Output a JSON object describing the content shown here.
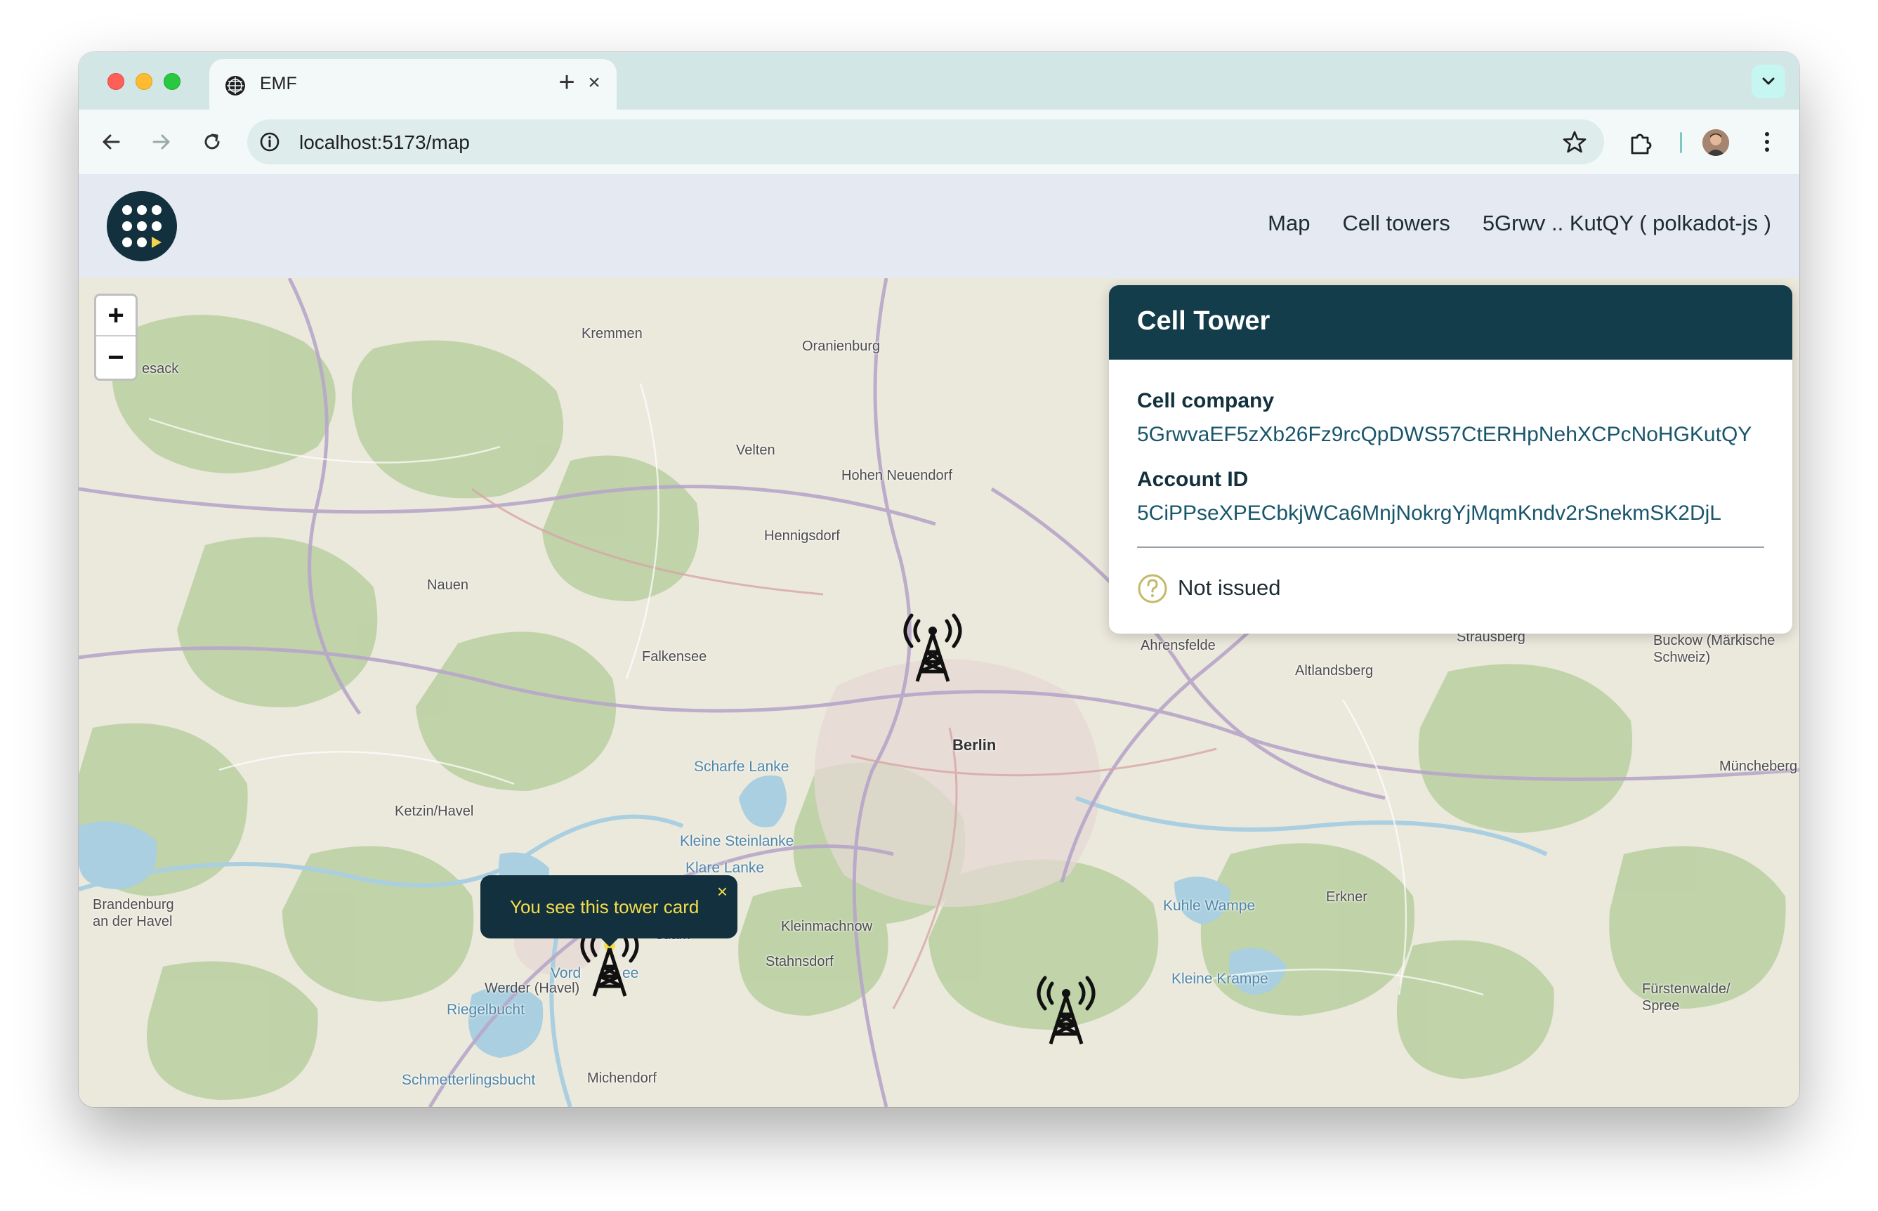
{
  "browser": {
    "tab_title": "EMF",
    "tab_close": "×",
    "new_tab": "+",
    "url": "localhost:5173/map"
  },
  "app": {
    "nav": {
      "map": "Map",
      "cell_towers": "Cell towers",
      "account": "5Grwv .. KutQY  ( polkadot-js )"
    }
  },
  "map": {
    "zoom_in": "+",
    "zoom_out": "−",
    "labels": [
      "Kremmen",
      "Oranienburg",
      "Velten",
      "Hohen Neuendorf",
      "Hennigsdorf",
      "Nauen",
      "Falkensee",
      "Berlin",
      "Scharfe Lanke",
      "Kleine Steinlanke",
      "Klare Lanke",
      "Ketzin/Havel",
      "Brandenburg an der Havel",
      "Werder (Havel)",
      "Riegelbucht",
      "Kleinmachnow",
      "Stahnsdorf",
      "Schmetterlingsbucht",
      "Michendorf",
      "Ahrensfelde",
      "Strausberg",
      "Altlandsberg",
      "Buckow (Märkische Schweiz)",
      "Müncheberg",
      "Erkner",
      "Kuhle Wampe",
      "Kleine Krampe",
      "Fürstenwalde/ Spree",
      "esack",
      "sdam",
      "Vord",
      "ee"
    ],
    "tooltip": {
      "text": "You see this tower card",
      "close": "×"
    }
  },
  "card": {
    "title": "Cell Tower",
    "company_label": "Cell company",
    "company_value": "5GrwvaEF5zXb26Fz9rcQpDWS57CtERHpNehXCPcNoHGKutQY",
    "account_label": "Account ID",
    "account_value": "5CiPPseXPECbkjWCa6MnjNokrgYjMqmKndv2rSnekmSK2DjL",
    "status": "Not issued"
  }
}
